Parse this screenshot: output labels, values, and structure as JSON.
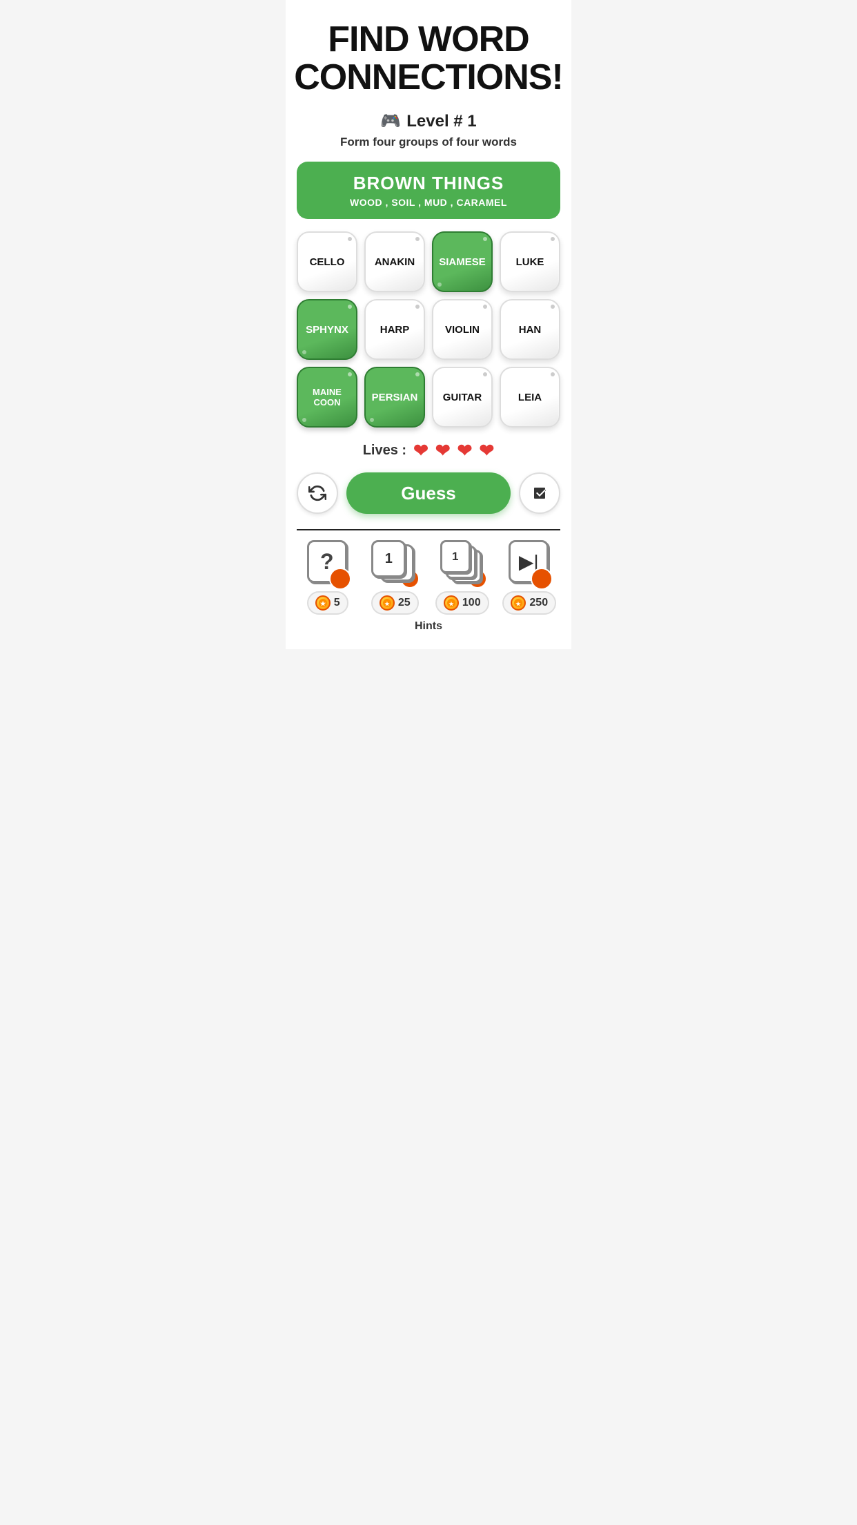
{
  "app": {
    "title_line1": "FIND WORD",
    "title_line2": "CONNECTIONS!"
  },
  "level": {
    "icon": "🎮",
    "label": "Level # 1",
    "subtitle": "Form four groups of four words"
  },
  "solved_banner": {
    "title": "BROWN THINGS",
    "words": "WOOD , SOIL , MUD , CARAMEL"
  },
  "tiles": [
    {
      "word": "CELLO",
      "selected": false
    },
    {
      "word": "ANAKIN",
      "selected": false
    },
    {
      "word": "SIAMESE",
      "selected": true
    },
    {
      "word": "LUKE",
      "selected": false
    },
    {
      "word": "SPHYNX",
      "selected": true
    },
    {
      "word": "HARP",
      "selected": false
    },
    {
      "word": "VIOLIN",
      "selected": false
    },
    {
      "word": "HAN",
      "selected": false
    },
    {
      "word": "MAINE\nCOON",
      "selected": true
    },
    {
      "word": "PERSIAN",
      "selected": true
    },
    {
      "word": "GUITAR",
      "selected": false
    },
    {
      "word": "LEIA",
      "selected": false
    }
  ],
  "lives": {
    "label": "Lives :",
    "count": 4,
    "heart": "❤"
  },
  "buttons": {
    "shuffle_label": "↺",
    "guess_label": "Guess",
    "eraser_label": "◆"
  },
  "hints": [
    {
      "cost": "5",
      "type": "question"
    },
    {
      "cost": "25",
      "type": "double"
    },
    {
      "cost": "100",
      "type": "triple"
    },
    {
      "cost": "250",
      "type": "play"
    }
  ],
  "hints_label": "Hints",
  "colors": {
    "green": "#4caf50",
    "dark_green": "#2e7d32",
    "red": "#e53935",
    "orange": "#e65100"
  }
}
